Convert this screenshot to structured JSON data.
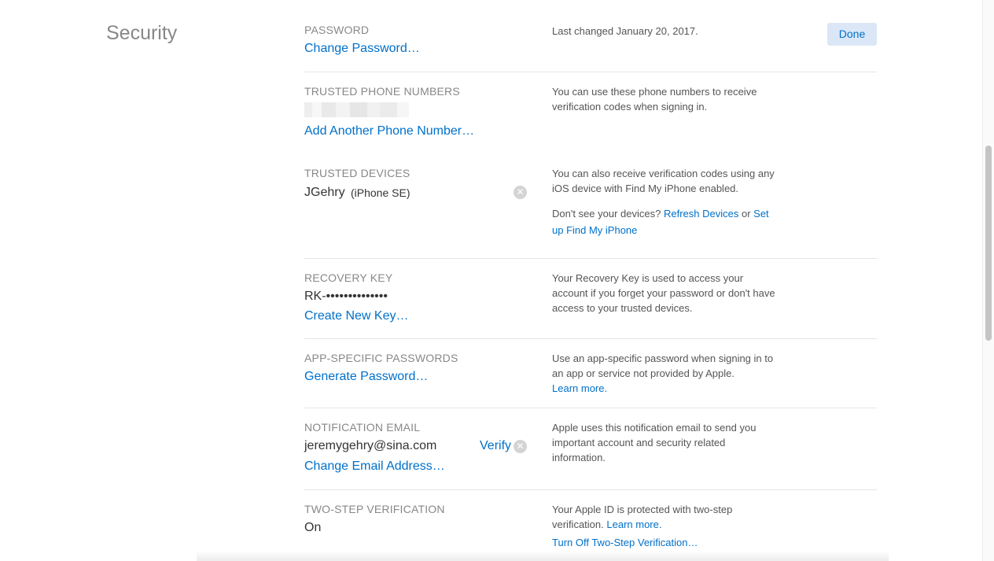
{
  "section_title": "Security",
  "done_label": "Done",
  "password": {
    "label": "PASSWORD",
    "link": "Change Password…",
    "desc": "Last changed January 20, 2017."
  },
  "phones": {
    "label": "TRUSTED PHONE NUMBERS",
    "link": "Add Another Phone Number…",
    "desc": "You can use these phone numbers to receive verification codes when signing in."
  },
  "devices": {
    "label": "TRUSTED DEVICES",
    "device_name": "JGehry",
    "device_model": "(iPhone SE)",
    "desc1": "You can also receive verification codes using any iOS device with Find My iPhone enabled.",
    "desc2_prefix": "Don't see your devices?",
    "refresh_link": "Refresh Devices",
    "or_text": "or",
    "setup_link": "Set up Find My iPhone"
  },
  "recovery": {
    "label": "RECOVERY KEY",
    "value": "RK-••••••••••••••",
    "link": "Create New Key…",
    "desc": "Your Recovery Key is used to access your account if you forget your password or don't have access to your trusted devices."
  },
  "app_passwords": {
    "label": "APP-SPECIFIC PASSWORDS",
    "link": "Generate Password…",
    "desc": "Use an app-specific password when signing in to an app or service not provided by Apple.",
    "learn_more": "Learn more."
  },
  "notification_email": {
    "label": "NOTIFICATION EMAIL",
    "email": "jeremygehry@sina.com",
    "verify": "Verify",
    "link": "Change Email Address…",
    "desc": "Apple uses this notification email to send you important account and security related information."
  },
  "two_step": {
    "label": "TWO-STEP VERIFICATION",
    "value": "On",
    "desc": "Your Apple ID is protected with two-step verification.",
    "learn_more": "Learn more.",
    "turn_off_link": "Turn Off Two-Step Verification…"
  },
  "icons": {
    "remove": "close-circle-icon",
    "x_glyph": "✕"
  }
}
